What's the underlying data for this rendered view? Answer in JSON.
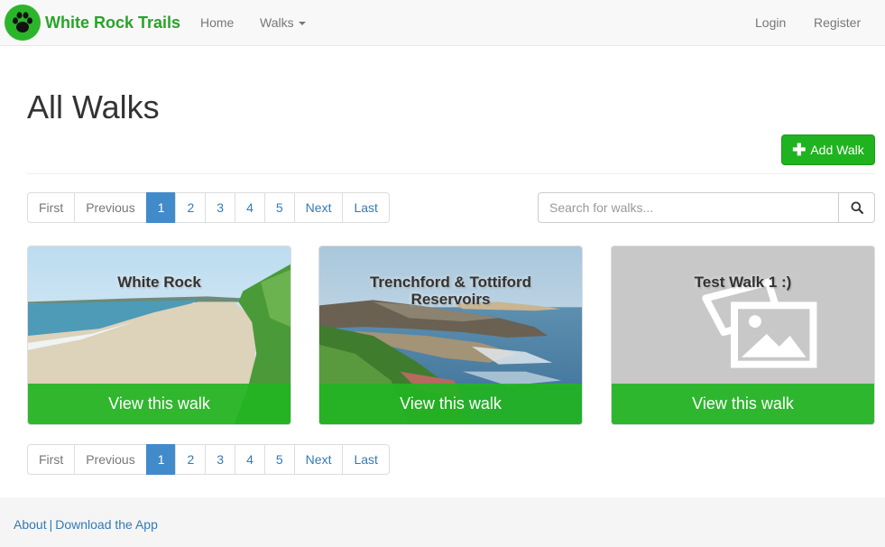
{
  "brand": {
    "name": "White Rock Trails",
    "color": "#28a428"
  },
  "nav": {
    "home": "Home",
    "walks": "Walks",
    "login": "Login",
    "register": "Register"
  },
  "page": {
    "title": "All Walks",
    "add_button": "Add Walk"
  },
  "pagination": {
    "first": "First",
    "previous": "Previous",
    "pages": [
      "1",
      "2",
      "3",
      "4",
      "5"
    ],
    "active_page": "1",
    "next": "Next",
    "last": "Last"
  },
  "search": {
    "placeholder": "Search for walks..."
  },
  "walks": [
    {
      "title": "White Rock",
      "button": "View this walk"
    },
    {
      "title": "Trenchford & Tottiford Reservoirs",
      "button": "View this walk"
    },
    {
      "title": "Test Walk 1 :)",
      "button": "View this walk"
    }
  ],
  "footer": {
    "about": "About",
    "separator": "|",
    "download": "Download the App"
  },
  "colors": {
    "accent_green": "#20b320",
    "link_blue": "#337ab7",
    "active_page": "#428bca"
  }
}
